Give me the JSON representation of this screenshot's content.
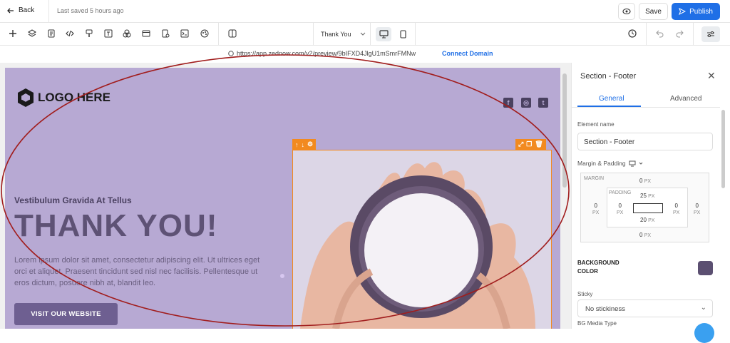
{
  "topbar": {
    "back_label": "Back",
    "saved_text": "Last saved 5 hours ago",
    "save_label": "Save",
    "publish_label": "Publish"
  },
  "toolbar": {
    "page_select": "Thank You",
    "icons": [
      "plus-icon",
      "layers-icon",
      "page-icon",
      "code-icon",
      "paint-icon",
      "text-icon",
      "shapes-icon",
      "browser-icon",
      "form-icon",
      "terminal-icon",
      "palette-icon",
      "columns-icon"
    ],
    "right_icons": [
      "history-icon",
      "undo-icon",
      "redo-icon",
      "settings-sliders-icon"
    ],
    "devices": [
      "desktop-icon",
      "mobile-icon"
    ]
  },
  "url_bar": {
    "url": "https://app.zednow.com/v2/preview/9bIFXD4JlgU1mSmrFMNw",
    "connect_label": "Connect Domain"
  },
  "canvas": {
    "logo_text": "LOGO HERE",
    "social": [
      "f",
      "◎",
      "t"
    ],
    "subheading": "Vestibulum Gravida At Tellus",
    "title": "THANK YOU!",
    "body": "Lorem ipsum dolor sit amet, consectetur adipiscing elit. Ut ultrices eget orci et aliquet. Praesent tincidunt sed nisl nec facilisis. Pellentesque ut eros dictum, posuere nibh at, blandit leo.",
    "cta_label": "VISIT OUR WEBSITE",
    "background_color": "#b7a9d3",
    "selection_color": "#f28a1f"
  },
  "panel": {
    "title": "Section - Footer",
    "tabs": [
      "General",
      "Advanced"
    ],
    "element_name_label": "Element name",
    "element_name_value": "Section - Footer",
    "margin_padding_label": "Margin & Padding",
    "margin_label": "MARGIN",
    "padding_label": "PADDING",
    "margin": {
      "top": "0",
      "right": "0",
      "bottom": "0",
      "left": "0"
    },
    "padding": {
      "top": "25",
      "right": "0",
      "bottom": "20",
      "left": "0"
    },
    "unit": "PX",
    "bg_color_label": "BACKGROUND COLOR",
    "bg_color_value": "#5b4f71",
    "sticky_label": "Sticky",
    "sticky_value": "No stickiness",
    "bg_media_label": "BG Media Type"
  }
}
